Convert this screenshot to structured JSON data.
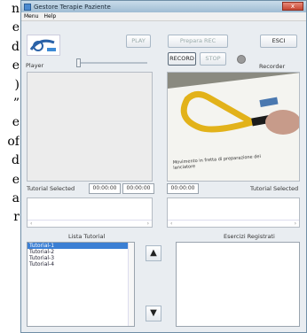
{
  "background_lines": [
    "n",
    "e",
    "d",
    "e",
    ")",
    "”",
    "e",
    "of",
    "d",
    "e",
    "a",
    "r"
  ],
  "window": {
    "title": "Gestore Terapie Paziente",
    "close_label": "x",
    "menu": [
      "Menu",
      "Help"
    ]
  },
  "toolbar": {
    "play": "PLAY",
    "prepara_rec": "Prepara REC",
    "esci": "ESCI",
    "record": "RECORD",
    "stop": "STOP"
  },
  "player_label": "Player",
  "recorder_label": "Recorder",
  "tutorial_selected_left": "Tutorial Selected",
  "time1": "00:00:00",
  "time2": "00:00:00",
  "time3": "00:00:00",
  "tutorial_selected_right": "Tutorial Selected",
  "lista_tutorial_label": "Lista Tutorial",
  "esercizi_label": "Esercizi Registrati",
  "tutorials": [
    "Tutorial-1",
    "Tutorial-2",
    "Tutorial-3",
    "Tutorial-4"
  ],
  "camera_text": "Movimento in fretta di preparazione dei lanciatore",
  "arrow_up": "▲",
  "arrow_down": "▼"
}
